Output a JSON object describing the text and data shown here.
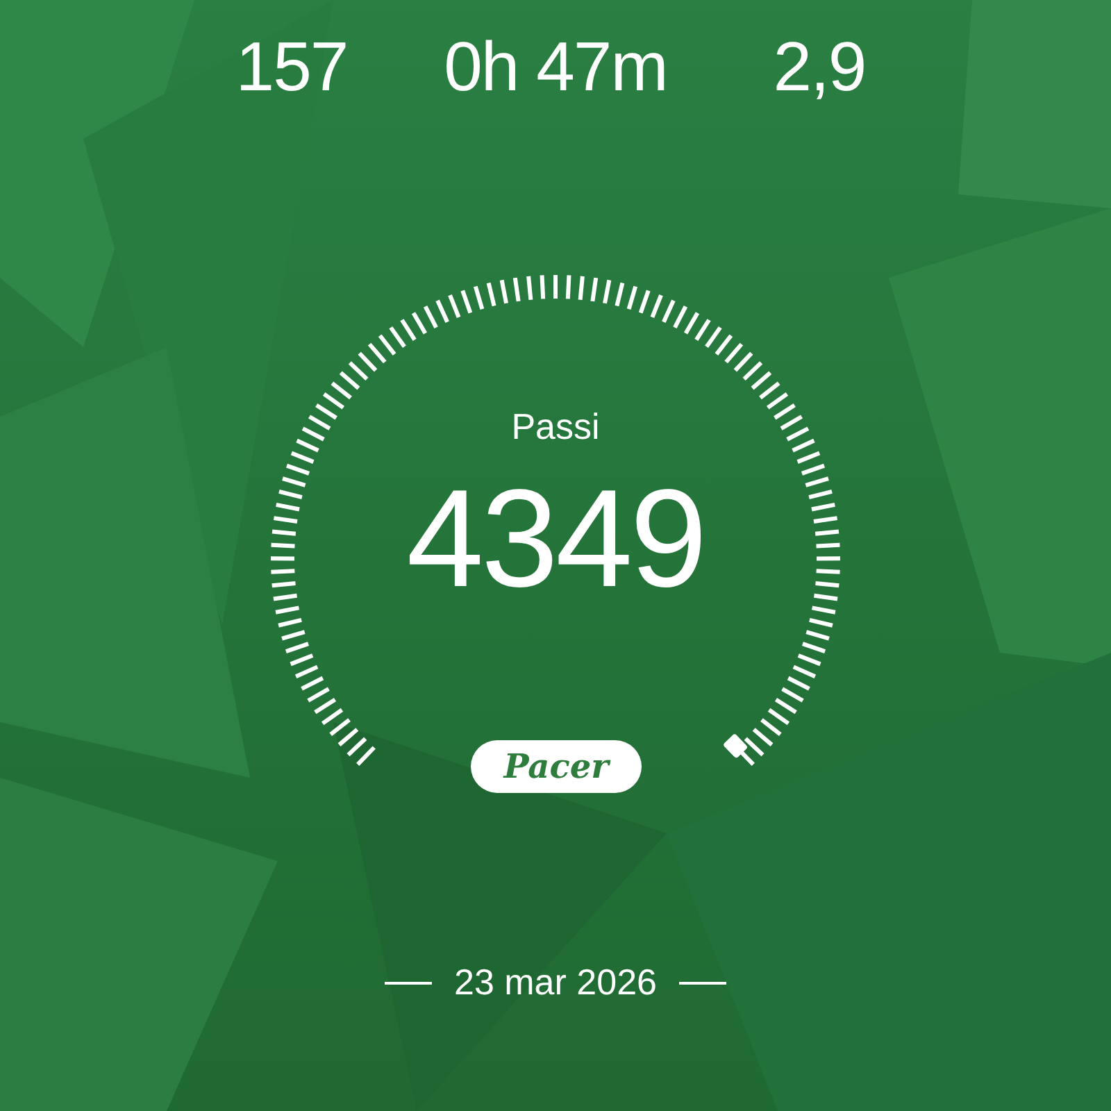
{
  "stats": [
    {
      "value": "157"
    },
    {
      "value": "0h 47m"
    },
    {
      "value": "2,9"
    }
  ],
  "gauge": {
    "label": "Passi",
    "value": "4349"
  },
  "brand": "Pacer",
  "date": "23 mar 2026"
}
